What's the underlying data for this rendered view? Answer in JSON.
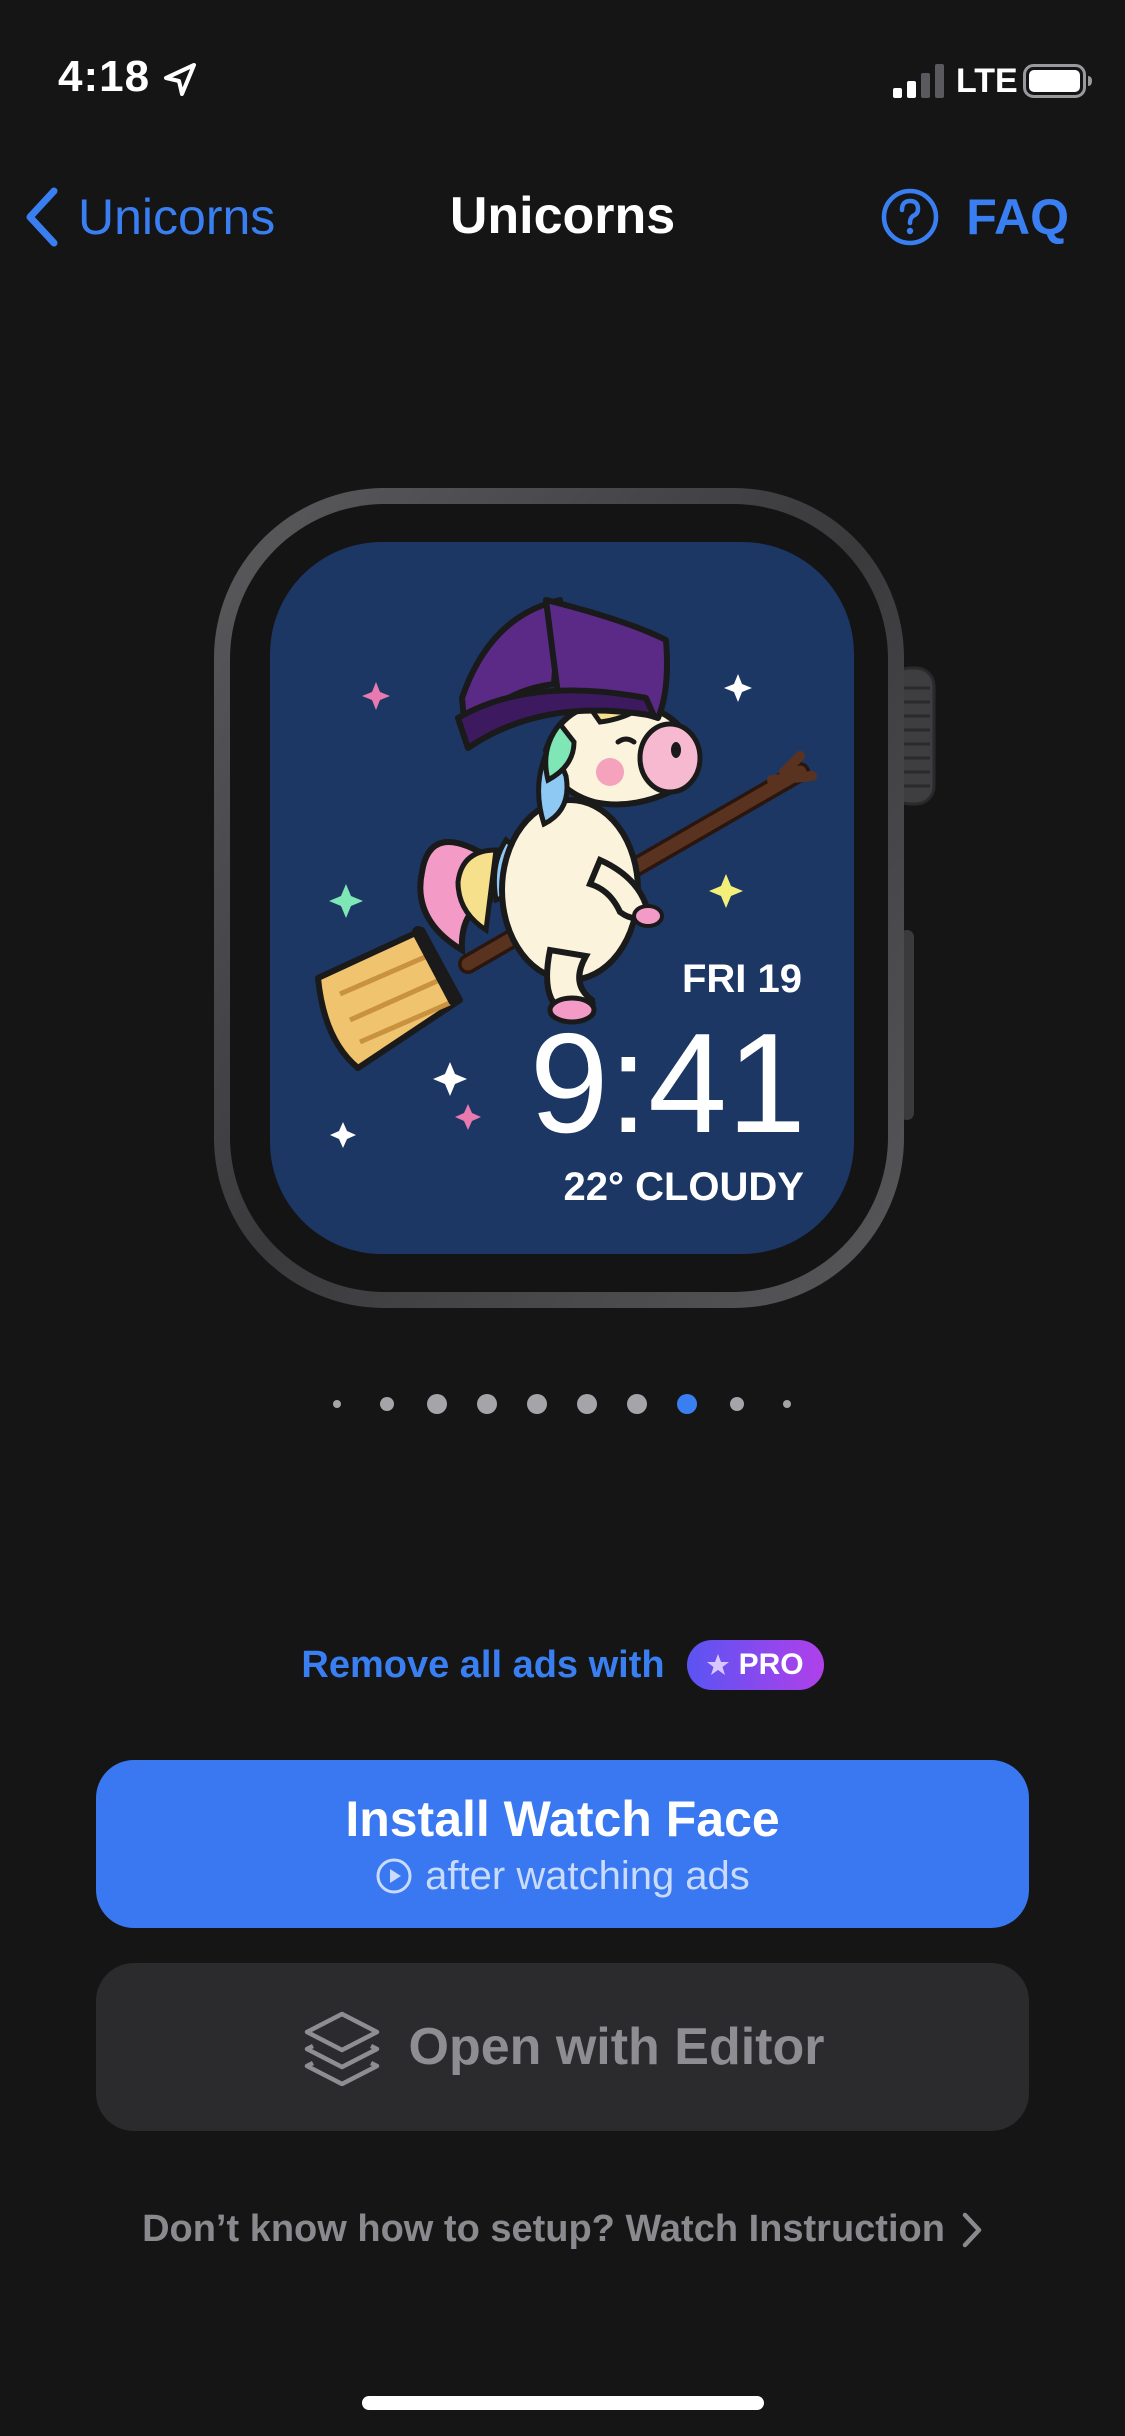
{
  "status_bar": {
    "time": "4:18",
    "network": "LTE"
  },
  "nav": {
    "back_label": "Unicorns",
    "title": "Unicorns",
    "faq_label": "FAQ"
  },
  "watch_face": {
    "date": "FRI 19",
    "time": "9:41",
    "weather": "22° CLOUDY"
  },
  "pagination": {
    "count": 10,
    "active_index": 7
  },
  "promo": {
    "text": "Remove all ads with",
    "badge": "PRO"
  },
  "install_button": {
    "title": "Install Watch Face",
    "subtitle": "after watching ads"
  },
  "editor_button": {
    "label": "Open with Editor"
  },
  "instruction": {
    "text": "Don’t know how to setup? Watch Instruction"
  },
  "colors": {
    "accent": "#3a7ff2",
    "background": "#151516",
    "face_bg": "#1c3764",
    "pro_gradient_start": "#5a54f2",
    "pro_gradient_end": "#b040ea"
  }
}
